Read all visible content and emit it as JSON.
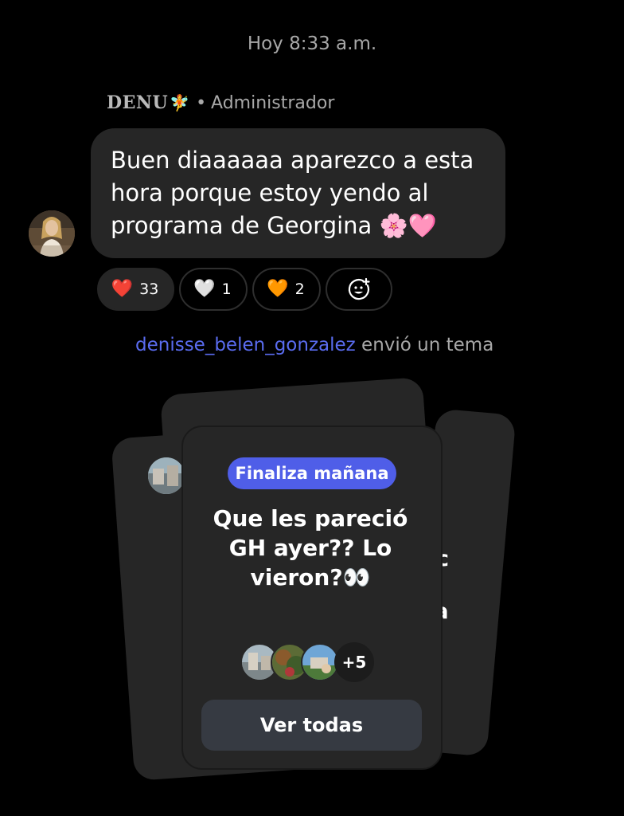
{
  "timestamp": "Hoy 8:33 a.m.",
  "message": {
    "sender_name": "DENU",
    "sender_emoji": "🧚",
    "separator": "•",
    "sender_role": "Administrador",
    "text": "Buen diaaaaaa aparezco a esta hora porque estoy yendo al programa de Georgina 🌸🩷"
  },
  "reactions": [
    {
      "emoji": "❤️",
      "count": "33",
      "active": true
    },
    {
      "emoji": "🤍",
      "count": "1",
      "active": false
    },
    {
      "emoji": "🧡",
      "count": "2",
      "active": false
    }
  ],
  "add_reaction_icon": "emoji-add-icon",
  "system_message": {
    "user": "denisse_belen_gonzalez",
    "action": "envió un tema"
  },
  "topic_card": {
    "badge": "Finaliza mañana",
    "title": "Que les pareció GH ayer?? Lo vieron?👀",
    "participants_more": "+5",
    "button": "Ver todas"
  },
  "background_cards": {
    "right_fragment_1": "c",
    "right_fragment_2": "da"
  },
  "colors": {
    "background": "#000000",
    "bubble": "#262626",
    "accent": "#4f5ee8",
    "username_link": "#5a6cf0",
    "muted_text": "#a8a8a8",
    "button": "#363a42"
  }
}
